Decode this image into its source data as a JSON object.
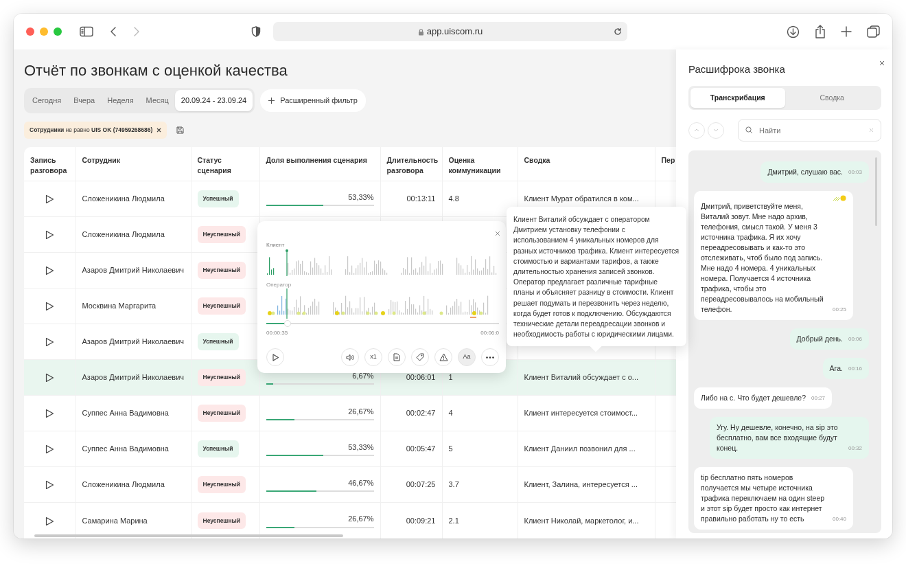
{
  "browser": {
    "url": "app.uiscom.ru"
  },
  "page": {
    "title": "Отчёт по звонкам с оценкой качества",
    "periods": [
      {
        "label": "Сегодня",
        "selected": false
      },
      {
        "label": "Вчера",
        "selected": false
      },
      {
        "label": "Неделя",
        "selected": false
      },
      {
        "label": "Месяц",
        "selected": false
      },
      {
        "label": "20.09.24 - 23.09.24",
        "selected": true
      }
    ],
    "advanced_filter": "Расширенный фильтр",
    "filter_chip": "**Сотрудники** не равно **UIS OK (74959268686)**"
  },
  "table": {
    "columns": [
      "Запись разговора",
      "Сотрудник",
      "Статус сценария",
      "Доля выполнения сценария",
      "Длительность разговора",
      "Оценка коммуникации",
      "Сводка",
      "Пер"
    ],
    "rows": [
      {
        "selected": false,
        "employee": "Сложеникина Людмила",
        "status": {
          "kind": "success",
          "label": "Успешный"
        },
        "completion": {
          "label": "53,33%",
          "level": 0.5333
        },
        "duration": "00:13:11",
        "score": "4.8",
        "summary": "Клиент Мурат обратился в ком..."
      },
      {
        "selected": false,
        "employee": "Сложеникина Людмила",
        "status": {
          "kind": "fail",
          "label": "Неуспешный"
        }
      },
      {
        "selected": false,
        "employee": "Азаров Дмитрий Николаевич",
        "status": {
          "kind": "fail",
          "label": "Неуспешный"
        }
      },
      {
        "selected": false,
        "employee": "Москвина Маргарита",
        "status": {
          "kind": "fail",
          "label": "Неуспешный"
        }
      },
      {
        "selected": false,
        "employee": "Азаров Дмитрий Николаевич",
        "status": {
          "kind": "success",
          "label": "Успешный"
        }
      },
      {
        "selected": true,
        "employee": "Азаров Дмитрий Николаевич",
        "status": {
          "kind": "fail",
          "label": "Неуспешный"
        },
        "completion": {
          "label": "6,67%",
          "level": 0.0667
        },
        "duration": "00:06:01",
        "score": "1",
        "summary": "Клиент Виталий обсуждает с о..."
      },
      {
        "selected": false,
        "employee": "Суппес Анна Вадимовна",
        "status": {
          "kind": "fail",
          "label": "Неуспешный"
        },
        "completion": {
          "label": "26,67%",
          "level": 0.2667
        },
        "duration": "00:02:47",
        "score": "4",
        "summary": "Клиент интересуется стоимост..."
      },
      {
        "selected": false,
        "employee": "Суппес Анна Вадимовна",
        "status": {
          "kind": "success",
          "label": "Успешный"
        },
        "completion": {
          "label": "53,33%",
          "level": 0.5333
        },
        "duration": "00:05:47",
        "score": "5",
        "summary": "Клиент Даниил позвонил для ..."
      },
      {
        "selected": false,
        "employee": "Сложеникина Людмила",
        "status": {
          "kind": "fail",
          "label": "Неуспешный"
        },
        "completion": {
          "label": "46,67%",
          "level": 0.4667
        },
        "duration": "00:07:25",
        "score": "3.7",
        "summary": "Клиент, Залина, интересуется ..."
      },
      {
        "selected": false,
        "employee": "Самарина Марина",
        "status": {
          "kind": "fail",
          "label": "Неуспешный"
        },
        "completion": {
          "label": "26,67%",
          "level": 0.2667
        },
        "duration": "00:09:21",
        "score": "2.1",
        "summary": "Клиент Николай, маркетолог, и..."
      }
    ]
  },
  "player": {
    "client_label": "Клиент",
    "operator_label": "Оператор",
    "position": "00:00:35",
    "total": "00:06:0",
    "level": 0.09,
    "speed": "x1",
    "font_button": "Aa"
  },
  "tooltip": {
    "text": "Клиент Виталий обсуждает с оператором Дмитрием установку телефонии с использованием 4 уникальных номеров для разных источников трафика. Клиент интересуется стоимостью и вариантами тарифов, а также длительностью хранения записей звонков. Оператор предлагает различные тарифные планы и объясняет разницу в стоимости. Клиент решает подумать и перезвонить через неделю, когда будет готов к подключению. Обсуждаются технические детали переадресации звонков и необходимость работы с юридическими лицами."
  },
  "panel": {
    "title": "Расшифрока звонка",
    "tabs": [
      {
        "label": "Транскрибация",
        "selected": true
      },
      {
        "label": "Сводка",
        "selected": false
      }
    ],
    "search": {
      "placeholder": "Найти"
    },
    "messages": [
      {
        "kind": "operator",
        "marked": false,
        "text": "Дмитрий, слушаю вас.",
        "time": "00:03"
      },
      {
        "kind": "client",
        "marked": true,
        "text": "Дмитрий, приветствуйте меня, Виталий зовут. Мне надо архив, телефония, смысл такой. У меня 3 источника трафика. Я их хочу переадресовывать и как-то это отслеживать, чтоб было под запись. Мне надо 4 номера. 4 уникальных номера. Получается 4 источника трафика, чтобы это переадресовывалось на мобильный телефон.",
        "time": "00:25"
      },
      {
        "kind": "operator",
        "marked": false,
        "text": "Добрый день.",
        "time": "00:06"
      },
      {
        "kind": "operator",
        "marked": false,
        "text": "Ага.",
        "time": "00:16"
      },
      {
        "kind": "client",
        "marked": false,
        "text": "Либо на с. Что будет дешевле?",
        "time": "00:27"
      },
      {
        "kind": "operator",
        "marked": false,
        "text": "Угу. Ну дешевле, конечно, на sip это бесплатно, вам все входящие будут конец.",
        "time": "00:32"
      },
      {
        "kind": "client",
        "marked": false,
        "text": "tip бесплатно пять номеров получается мы четыре источника трафика переключаем на один steep и этот sip будет просто как интернет правильно работать ну то есть",
        "time": "00:40"
      }
    ]
  }
}
